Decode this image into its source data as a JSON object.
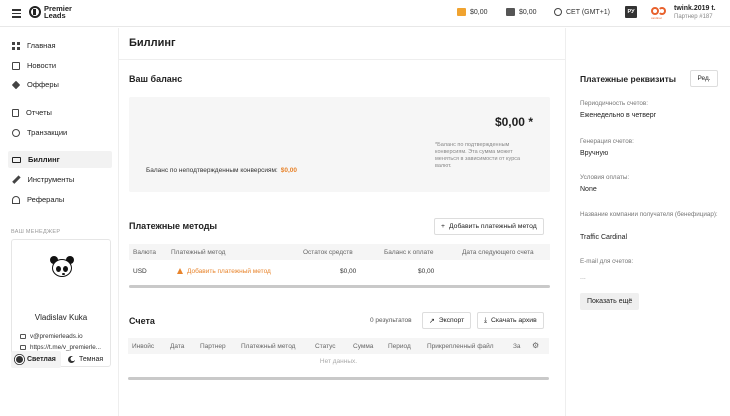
{
  "topbar": {
    "logo_line1": "Premier",
    "logo_line2": "Leads",
    "balance1": "$0,00",
    "balance2": "$0,00",
    "timezone": "CET (GMT+1)",
    "lang": "РУ",
    "user_name": "twink.2019 t.",
    "partner_id": "Партнер #187",
    "icons": [
      "menu-icon",
      "bag-icon",
      "wallet-icon",
      "clock-icon",
      "partner-logo-icon"
    ]
  },
  "sidebar": {
    "items": [
      {
        "label": "Главная",
        "icon": "dashboard-icon"
      },
      {
        "label": "Новости",
        "icon": "news-icon"
      },
      {
        "label": "Офферы",
        "icon": "tag-icon"
      },
      {
        "label": "Отчеты",
        "icon": "report-icon"
      },
      {
        "label": "Транзакции",
        "icon": "transactions-icon"
      },
      {
        "label": "Биллинг",
        "icon": "card-icon",
        "active": true
      },
      {
        "label": "Инструменты",
        "icon": "tools-icon"
      },
      {
        "label": "Рефералы",
        "icon": "referrals-icon"
      }
    ],
    "manager_label": "ВАШ МЕНЕДЖЕР",
    "manager_name": "Vladislav Kuka",
    "manager_email": "v@premierleads.io",
    "manager_telegram": "https://t.me/v_premierle...",
    "theme_light": "Светлая",
    "theme_dark": "Темная"
  },
  "main": {
    "title": "Биллинг",
    "balance_title": "Ваш баланс",
    "balance_amount": "$0,00 *",
    "balance_note": "*Баланс по подтвержденным конверсиям. Эта сумма может меняться в зависимости от курса валют.",
    "unconfirmed_label": "Баланс по неподтвержденным конверсиям:",
    "unconfirmed_value": "$0,00",
    "methods_title": "Платежные методы",
    "add_method_label": "Добавить платежный метод",
    "methods_columns": [
      "Валюта",
      "Платежный метод",
      "Остаток средств",
      "Баланс к оплате",
      "Дата следующего счета"
    ],
    "methods_rows": [
      {
        "currency": "USD",
        "method": "Добавить платежный метод",
        "remaining": "$0,00",
        "to_pay": "$0,00",
        "next_date": ""
      }
    ],
    "invoices_title": "Счета",
    "results_count": "0 результатов",
    "export_label": "Экспорт",
    "download_label": "Скачать архив",
    "invoice_columns": [
      "Инвойс",
      "Дата",
      "Партнер",
      "Платежный метод",
      "Статус",
      "Сумма",
      "Период",
      "Прикрепленный файл",
      "За"
    ],
    "no_data": "Нет данных."
  },
  "requisites": {
    "title": "Платежные реквизиты",
    "edit_label": "Ред.",
    "fields": [
      {
        "label": "Периодичность счетов:",
        "value": "Еженедельно в четверг"
      },
      {
        "label": "Генерация счетов:",
        "value": "Вручную"
      },
      {
        "label": "Условия оплаты:",
        "value": "None"
      },
      {
        "label": "Название компании получателя (бенефициар):",
        "value": "Traffic Cardinal"
      },
      {
        "label": "E-mail для счетов:",
        "value": "..."
      }
    ],
    "show_more": "Показать ещё"
  },
  "colors": {
    "accent": "#e8842c",
    "partner_brand": "#e8612c"
  }
}
